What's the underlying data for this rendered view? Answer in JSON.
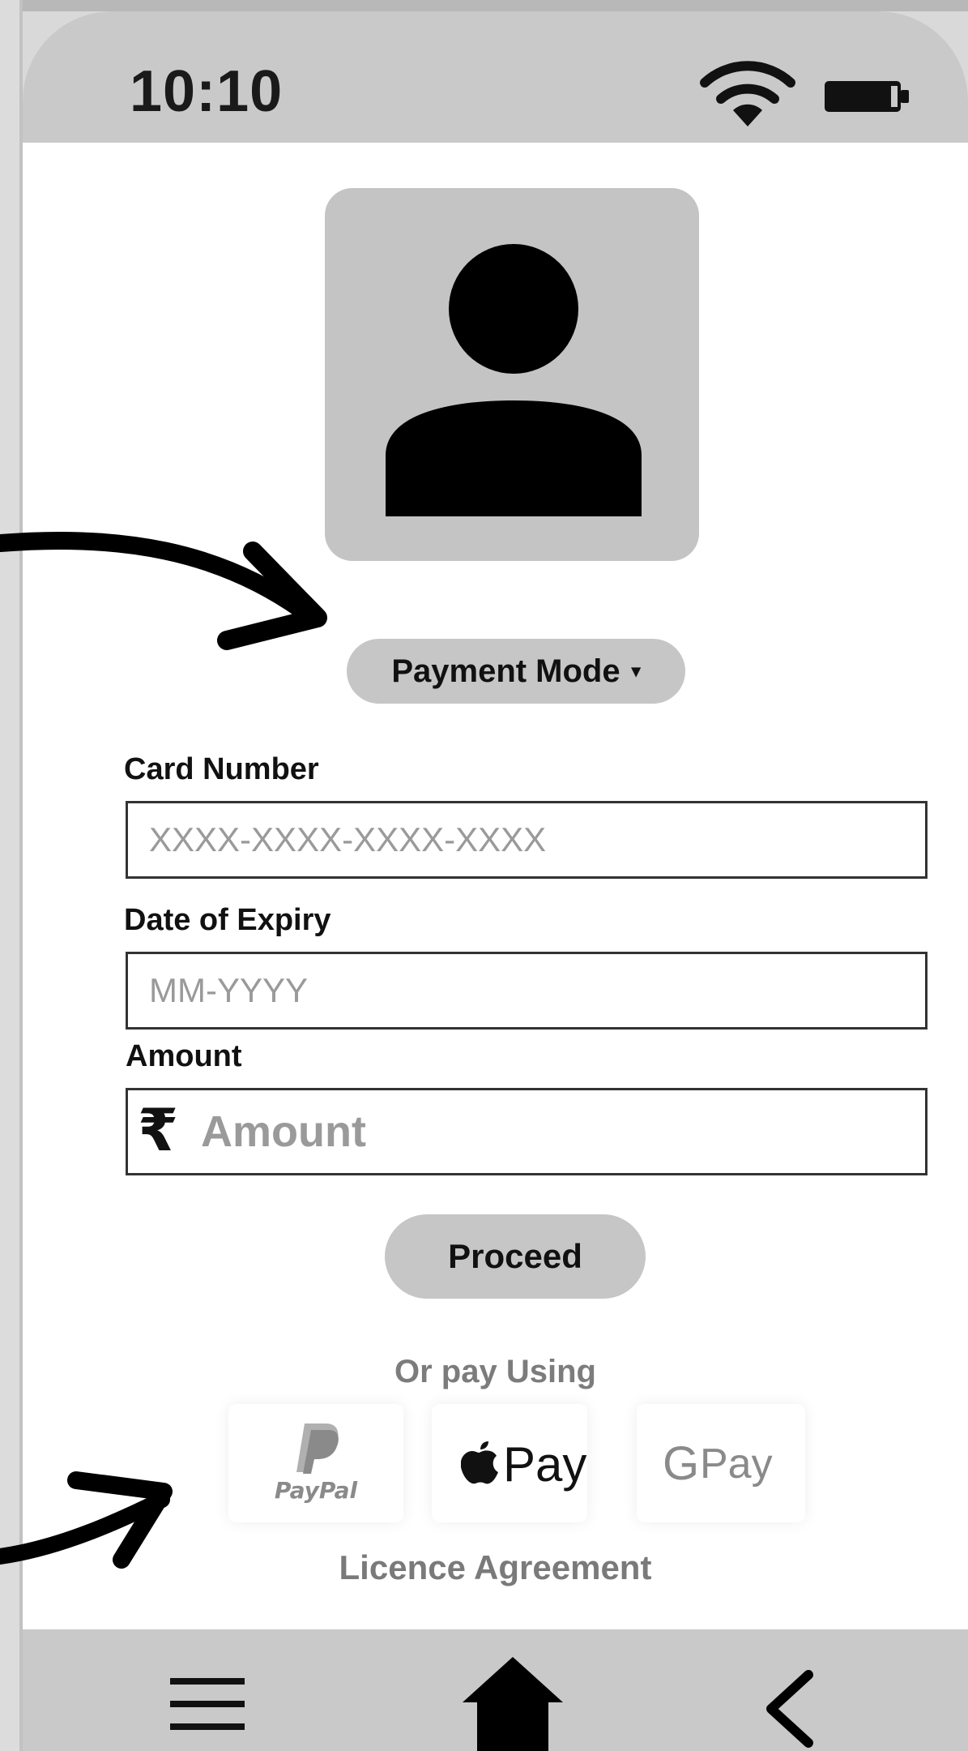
{
  "status_bar": {
    "time": "10:10"
  },
  "payment_mode": {
    "label": "Payment Mode",
    "caret": "▾"
  },
  "card_number": {
    "label": "Card Number",
    "placeholder": "XXXX-XXXX-XXXX-XXXX",
    "value": ""
  },
  "expiry": {
    "label": "Date of Expiry",
    "placeholder": "MM-YYYY",
    "value": ""
  },
  "amount": {
    "label": "Amount",
    "currency_symbol": "₹",
    "placeholder": "Amount",
    "value": ""
  },
  "proceed_label": "Proceed",
  "alt_payment": {
    "heading": "Or pay Using",
    "paypal": "PayPal",
    "applepay": "Pay",
    "gpay_g": "G",
    "gpay": "Pay"
  },
  "licence_link": "Licence Agreement",
  "nav": {
    "icons": [
      "menu-icon",
      "home-icon",
      "back-icon"
    ]
  },
  "colors": {
    "chrome": "#c9c9c9",
    "button": "#c6c6c6",
    "muted_text": "#7c7c7c"
  }
}
